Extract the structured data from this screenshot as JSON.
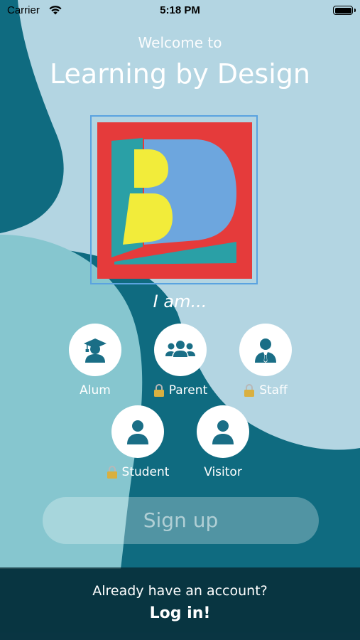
{
  "status_bar": {
    "carrier": "Carrier",
    "time": "5:18 PM"
  },
  "header": {
    "welcome": "Welcome to",
    "title": "Learning by Design"
  },
  "prompt": "I am...",
  "roles": [
    {
      "label": "Alum",
      "icon": "graduate-icon",
      "locked": false
    },
    {
      "label": "Parent",
      "icon": "group-icon",
      "locked": true
    },
    {
      "label": "Staff",
      "icon": "staff-person-icon",
      "locked": true
    },
    {
      "label": "Student",
      "icon": "person-icon",
      "locked": true
    },
    {
      "label": "Visitor",
      "icon": "person-icon",
      "locked": false
    }
  ],
  "signup": {
    "label": "Sign up"
  },
  "footer": {
    "question": "Already have an account?",
    "login": "Log in!"
  },
  "colors": {
    "background_dark": "#0f6b80",
    "background_light": "#b3d5e2",
    "background_mid": "#86c6cf",
    "logo_red": "#e53b3b",
    "logo_blue": "#6da6de",
    "logo_yellow": "#f2ec3a",
    "logo_teal": "#2aa0a6",
    "icon_color": "#1a6e86"
  }
}
